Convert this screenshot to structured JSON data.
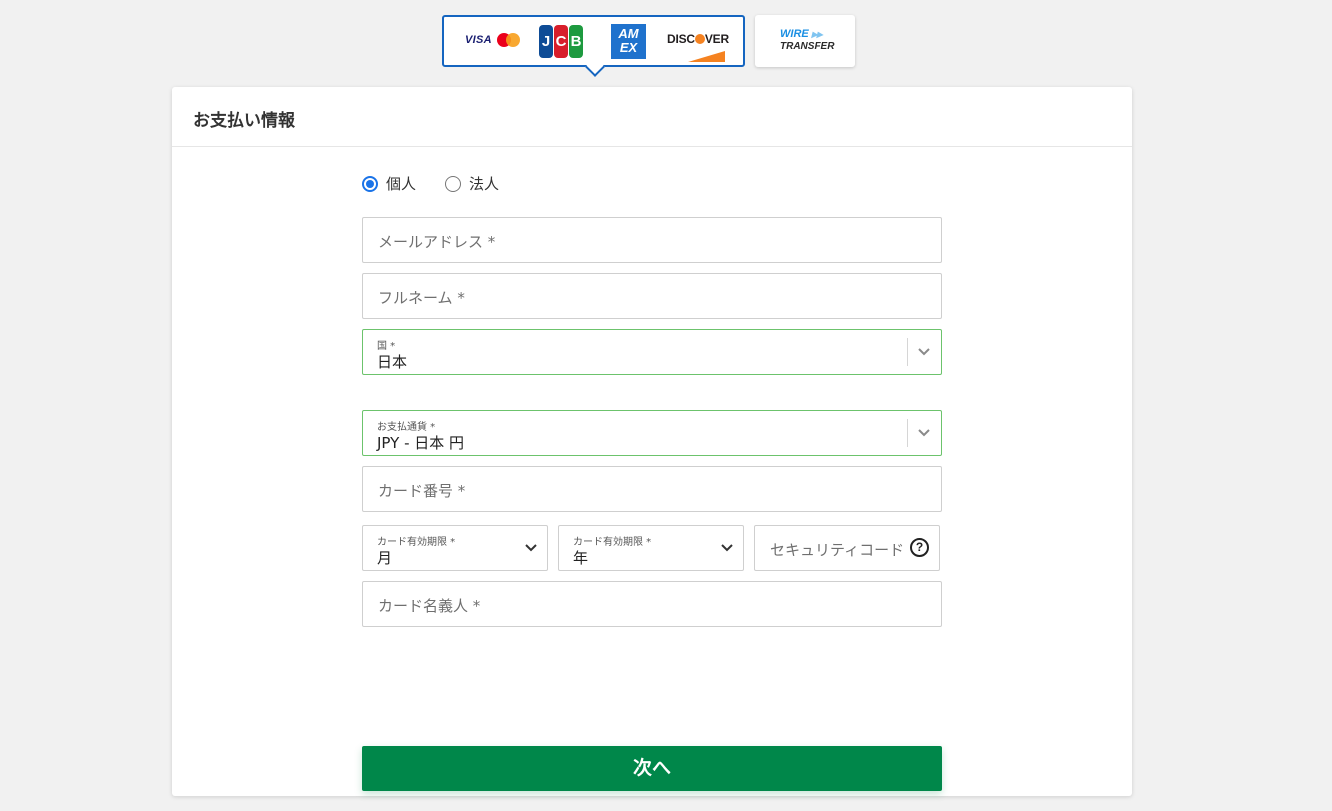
{
  "payment_methods": {
    "card": {
      "visa": "VISA",
      "jcb": [
        "J",
        "C",
        "B"
      ],
      "amex": [
        "AM",
        "EX"
      ],
      "discover": "DISC",
      "discover_rest": "VER",
      "active": true
    },
    "wire": {
      "line1": "WIRE",
      "arrows": "▶▶",
      "line2": "TRANSFER"
    }
  },
  "panel": {
    "title": "お支払い情報"
  },
  "customer_type": {
    "options": [
      {
        "label": "個人",
        "selected": true
      },
      {
        "label": "法人",
        "selected": false
      }
    ]
  },
  "fields": {
    "email": {
      "placeholder": "メールアドレス *"
    },
    "full_name": {
      "placeholder": "フルネーム *"
    },
    "country": {
      "label": "国 *",
      "value": "日本"
    },
    "currency": {
      "label": "お支払通貨 *",
      "value": "JPY - 日本 円"
    },
    "card_number": {
      "placeholder": "カード番号 *"
    },
    "exp_month": {
      "label": "カード有効期限 *",
      "value": "月"
    },
    "exp_year": {
      "label": "カード有効期限 *",
      "value": "年"
    },
    "security_code": {
      "placeholder": "セキュリティコード"
    },
    "card_holder": {
      "placeholder": "カード名義人 *"
    }
  },
  "submit": {
    "label": "次へ"
  },
  "colors": {
    "accent_blue": "#1565c0",
    "valid_green": "#6cc36c",
    "button_green": "#00874a",
    "background": "#f1f1f1"
  },
  "icons": {
    "dropdown": "chevron-down-icon",
    "help": "question-circle-icon"
  }
}
